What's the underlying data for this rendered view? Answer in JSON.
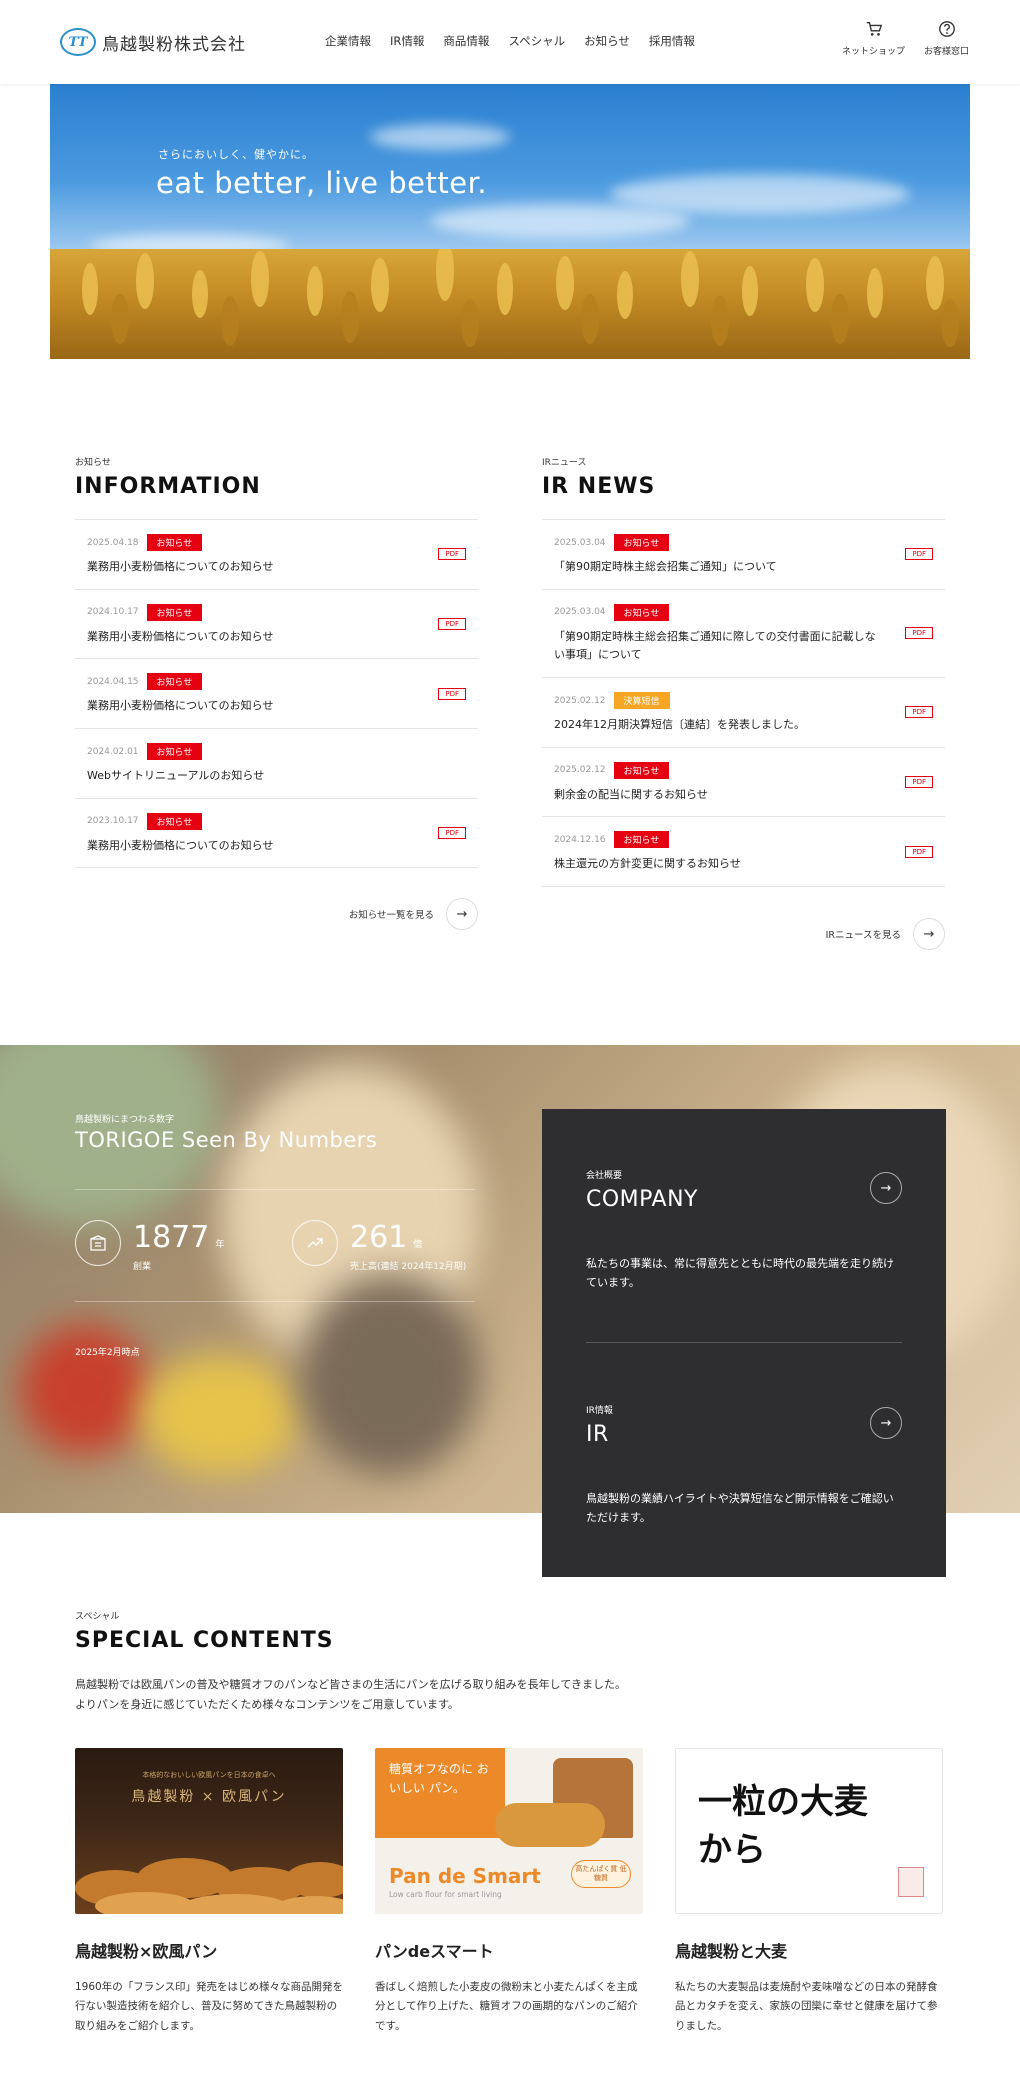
{
  "header": {
    "logo_text": "鳥越製粉株式会社",
    "logo_mark": "TT",
    "nav": [
      "企業情報",
      "IR情報",
      "商品情報",
      "スペシャル",
      "お知らせ",
      "採用情報"
    ],
    "shop_label": "ネットショップ",
    "support_label": "お客様窓口"
  },
  "hero": {
    "sub": "さらにおいしく、健やかに。",
    "title": "eat better, live better."
  },
  "information": {
    "label": "お知らせ",
    "title": "INFORMATION",
    "items": [
      {
        "date": "2025.04.18",
        "tag": "お知らせ",
        "text": "業務用小麦粉価格についてのお知らせ",
        "pdf": "PDF"
      },
      {
        "date": "2024.10.17",
        "tag": "お知らせ",
        "text": "業務用小麦粉価格についてのお知らせ",
        "pdf": "PDF"
      },
      {
        "date": "2024.04.15",
        "tag": "お知らせ",
        "text": "業務用小麦粉価格についてのお知らせ",
        "pdf": "PDF"
      },
      {
        "date": "2024.02.01",
        "tag": "お知らせ",
        "text": "Webサイトリニューアルのお知らせ",
        "pdf": ""
      },
      {
        "date": "2023.10.17",
        "tag": "お知らせ",
        "text": "業務用小麦粉価格についてのお知らせ",
        "pdf": "PDF"
      }
    ],
    "more_label": "お知らせ一覧を見る"
  },
  "irnews": {
    "label": "IRニュース",
    "title": "IR NEWS",
    "items": [
      {
        "date": "2025.03.04",
        "tag": "お知らせ",
        "text": "「第90期定時株主総会招集ご通知」について",
        "pdf": "PDF"
      },
      {
        "date": "2025.03.04",
        "tag": "お知らせ",
        "text": "「第90期定時株主総会招集ご通知に際しての交付書面に記載しない事項」について",
        "pdf": "PDF"
      },
      {
        "date": "2025.02.12",
        "tag": "決算短信",
        "text": "2024年12月期決算短信〔連結〕を発表しました。",
        "pdf": "PDF"
      },
      {
        "date": "2025.02.12",
        "tag": "お知らせ",
        "text": "剰余金の配当に関するお知らせ",
        "pdf": "PDF"
      },
      {
        "date": "2024.12.16",
        "tag": "お知らせ",
        "text": "株主還元の方針変更に関するお知らせ",
        "pdf": "PDF"
      }
    ],
    "more_label": "IRニュースを見る"
  },
  "numbers": {
    "label": "鳥越製粉にまつわる数字",
    "title": "TORIGOE Seen By Numbers",
    "founded": {
      "value": "1877",
      "unit": "年",
      "caption": "創業"
    },
    "sales": {
      "value": "261",
      "unit": "億",
      "caption": "売上高(連結 2024年12月期)"
    },
    "note": "2025年2月時点"
  },
  "company": {
    "label": "会社概要",
    "title": "COMPANY",
    "desc": "私たちの事業は、常に得意先とともに時代の最先端を走り続けています。"
  },
  "ir": {
    "label": "IR情報",
    "title": "IR",
    "desc": "鳥越製粉の業績ハイライトや決算短信など開示情報をご確認いただけます。"
  },
  "special": {
    "label": "スペシャル",
    "title": "SPECIAL CONTENTS",
    "desc_1": "鳥越製粉では欧風パンの普及や糖質オフのパンなど皆さまの生活にパンを広げる取り組みを長年してきました。",
    "desc_2": "よりパンを身近に感じていただくため様々なコンテンツをご用意しています。",
    "cards": [
      {
        "title": "鳥越製粉×欧風パン",
        "text": "1960年の「フランス印」発売をはじめ様々な商品開発を行ない製造技術を紹介し、普及に努めてきた鳥越製粉の取り組みをご紹介します。",
        "thumb_caption": "鳥越製粉 × 欧風パン",
        "thumb_sub": "本格的なおいしい欧風パンを日本の食卓へ"
      },
      {
        "title": "パンdeスマート",
        "text": "香ばしく焙煎した小麦皮の微粉末と小麦たんぱくを主成分として作り上げた、糖質オフの画期的なパンのご紹介です。",
        "thumb_caption": "糖質オフなのに おいしい パン。",
        "thumb_logo": "Pan de Smart",
        "thumb_sub": "Low carb flour for smart living",
        "thumb_badge": "高たんぱく質 低糖質"
      },
      {
        "title": "鳥越製粉と大麦",
        "text": "私たちの大麦製品は麦焼酎や麦味噌などの日本の発酵食品とカタチを変え、家族の団欒に幸せと健康を届けて参りました。",
        "thumb_caption": "一粒の大麦から"
      }
    ]
  }
}
